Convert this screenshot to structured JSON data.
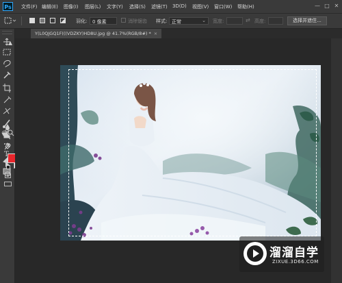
{
  "app": {
    "logo": "Ps"
  },
  "menu": [
    "文件(F)",
    "编辑(E)",
    "图像(I)",
    "图层(L)",
    "文字(Y)",
    "选择(S)",
    "滤镜(T)",
    "3D(D)",
    "视图(V)",
    "窗口(W)",
    "帮助(H)"
  ],
  "window_controls": {
    "minimize": "—",
    "maximize": "□",
    "close": "✕"
  },
  "options": {
    "feather_label": "羽化:",
    "feather_value": "0 像素",
    "antialias_label": "消除锯齿",
    "style_label": "样式:",
    "style_value": "正常",
    "width_label": "宽度:",
    "height_label": "高度:",
    "select_mask_button": "选择并遮住..."
  },
  "document_tab": {
    "title": "Y(L0QJGQ1F(((VDZKY)HD8U.jpg @ 41.7%(RGB/8#) *",
    "close": "×"
  },
  "colors": {
    "foreground": "#e8262c",
    "background": "#ffffff",
    "accent": "#31a8ff"
  },
  "tools": [
    "move-tool",
    "marquee-tool",
    "lasso-tool",
    "quick-select-tool",
    "crop-tool",
    "eyedropper-tool",
    "healing-tool",
    "brush-tool",
    "clone-stamp-tool",
    "history-brush-tool",
    "eraser-tool",
    "gradient-tool",
    "blur-tool",
    "dodge-tool",
    "pen-tool",
    "type-tool",
    "path-select-tool",
    "shape-tool",
    "hand-tool",
    "zoom-tool",
    "more-tools"
  ],
  "watermark": {
    "title": "溜溜自学",
    "url": "ZIXUE.3D66.COM"
  }
}
